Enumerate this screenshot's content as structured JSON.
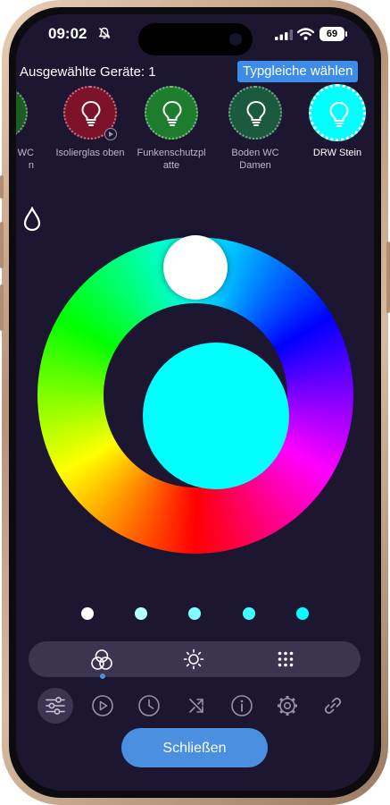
{
  "status_bar": {
    "time": "09:02",
    "battery": "69"
  },
  "header": {
    "selected_label": "Ausgewählte Geräte: 1",
    "match_button": "Typgleiche wählen"
  },
  "devices": [
    {
      "name": "WC\nn",
      "color": "#1c5b23"
    },
    {
      "name": "Isolierglas oben",
      "color": "#7d1228"
    },
    {
      "name": "Funkenschutzpl\natte",
      "color": "#1e7d2d"
    },
    {
      "name": "Boden WC\nDamen",
      "color": "#1b5a3c"
    },
    {
      "name": "DRW Stein",
      "color": "#00ffff"
    }
  ],
  "current_color": "#00ffff",
  "swatches": [
    "#ffffff",
    "#b4ffff",
    "#80ffff",
    "#40ffff",
    "#00ffff"
  ],
  "close_button": "Schließen",
  "colors": {
    "background": "#1d1631",
    "accent": "#4a8fe0",
    "bar": "#3c3551"
  }
}
